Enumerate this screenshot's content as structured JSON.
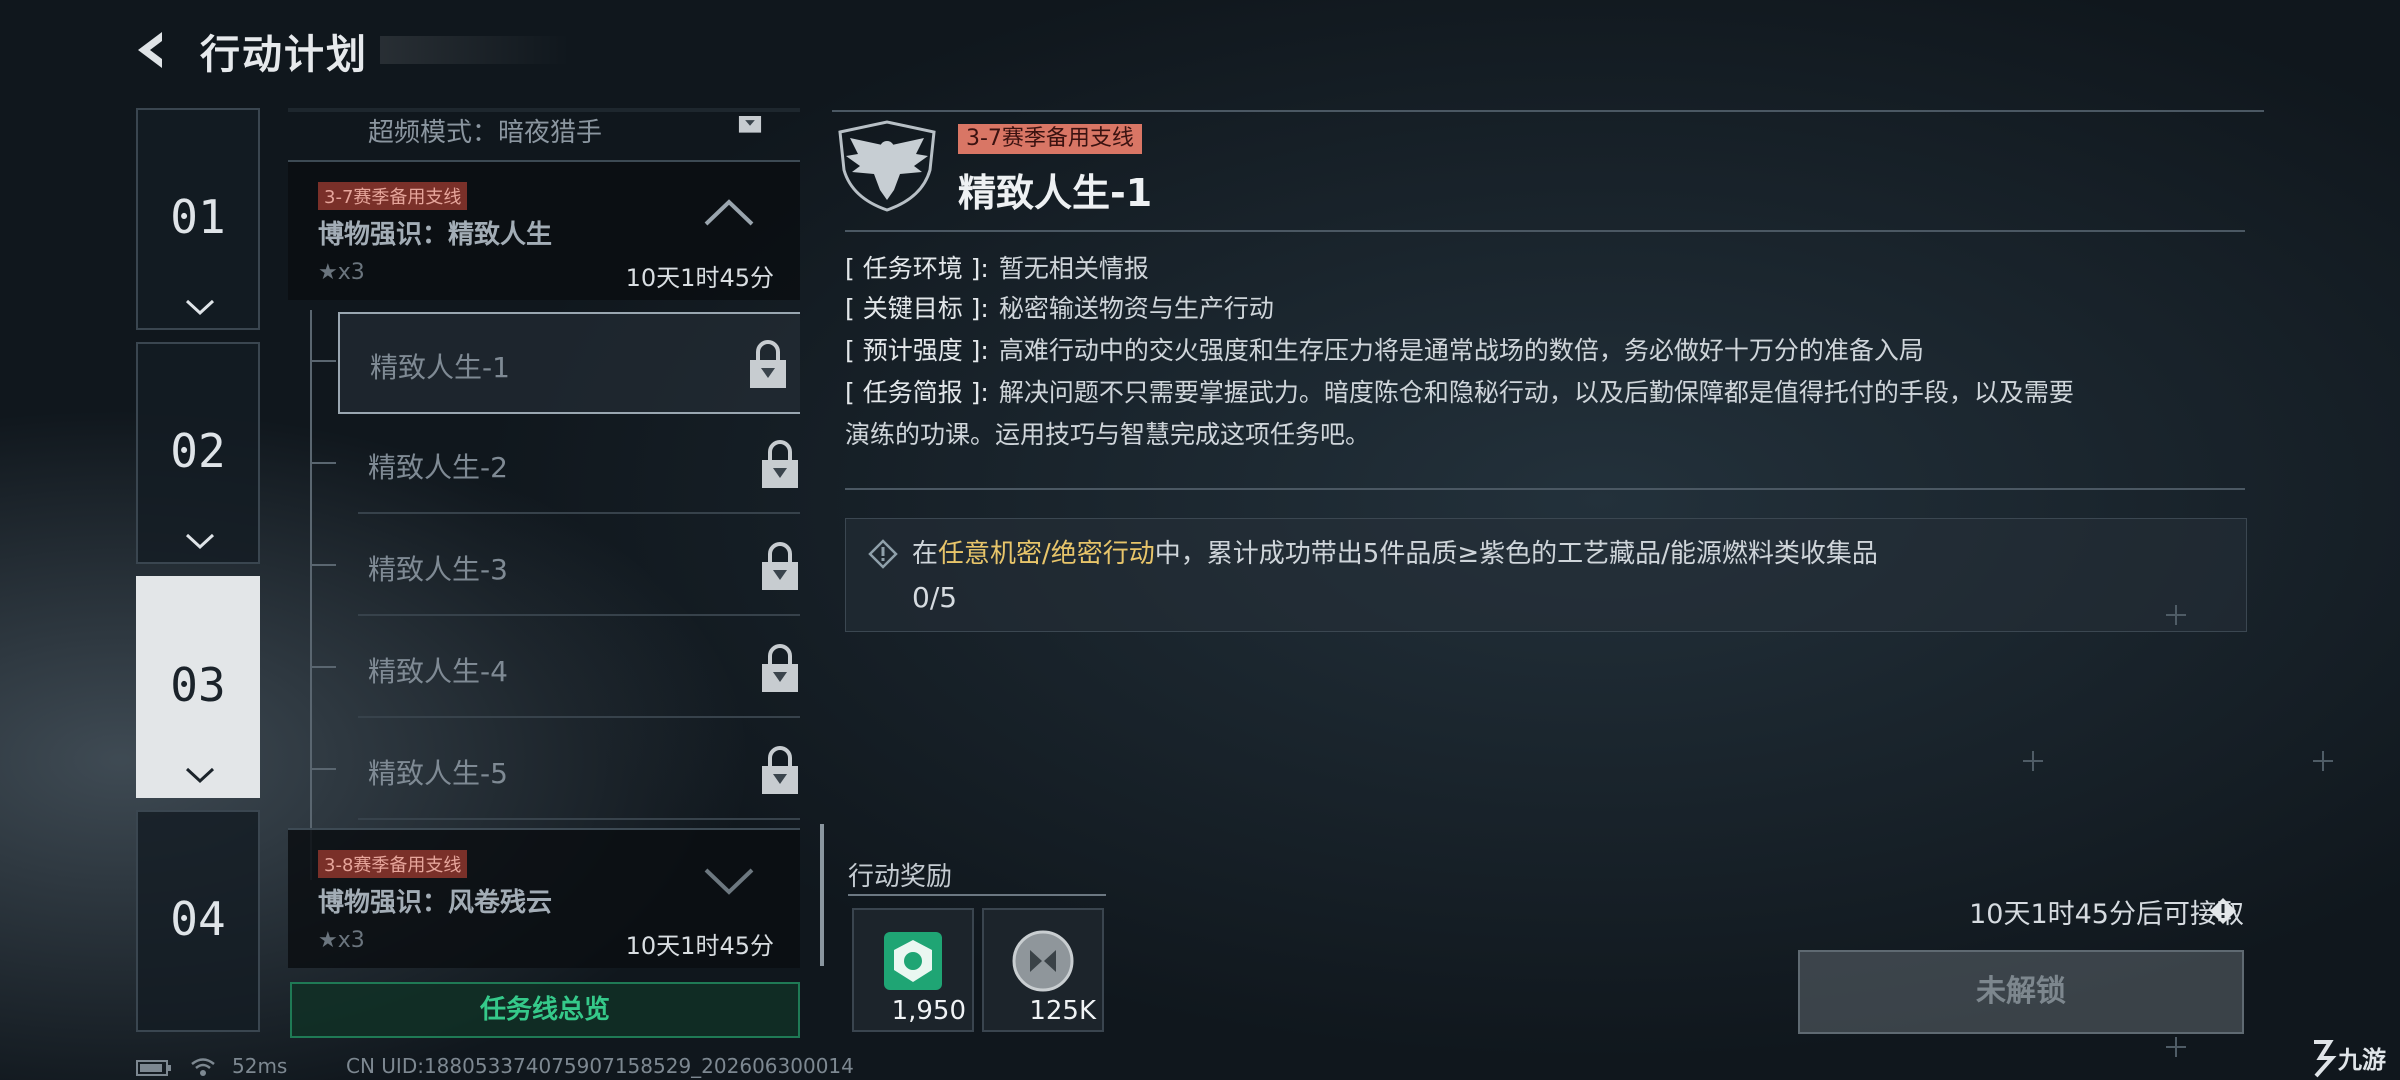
{
  "header": {
    "title": "行动计划",
    "back_icon": "back-arrow-icon"
  },
  "chapters": [
    {
      "label": "01",
      "active": false
    },
    {
      "label": "02",
      "active": false
    },
    {
      "label": "03",
      "active": true
    },
    {
      "label": "04",
      "active": false
    }
  ],
  "mission_list": {
    "cut_off_text": "超频模式：暗夜猎手",
    "groups": [
      {
        "tag": "3-7赛季备用支线",
        "title": "博物强识：精致人生",
        "stars": "★x3",
        "time": "10天1时45分",
        "expanded": true,
        "items": [
          {
            "label": "精致人生-1",
            "locked": true,
            "selected": true
          },
          {
            "label": "精致人生-2",
            "locked": true
          },
          {
            "label": "精致人生-3",
            "locked": true
          },
          {
            "label": "精致人生-4",
            "locked": true
          },
          {
            "label": "精致人生-5",
            "locked": true
          }
        ]
      },
      {
        "tag": "3-8赛季备用支线",
        "title": "博物强识：风卷残云",
        "stars": "★x3",
        "time": "10天1时45分",
        "expanded": false
      }
    ],
    "overview_button": "任务线总览"
  },
  "detail": {
    "tag": "3-7赛季备用支线",
    "title": "精致人生-1",
    "info": [
      {
        "key": "[ 任务环境 ]:",
        "value": "暂无相关情报"
      },
      {
        "key": "[ 关键目标 ]:",
        "value": "秘密输送物资与生产行动"
      },
      {
        "key": "[ 预计强度 ]:",
        "value": "高难行动中的交火强度和生存压力将是通常战场的数倍，务必做好十万分的准备入局"
      },
      {
        "key": "[ 任务简报 ]:",
        "value": "解决问题不只需要掌握武力。暗度陈仓和隐秘行动，以及后勤保障都是值得托付的手段，以及需要"
      },
      {
        "key": "",
        "value": "演练的功课。运用技巧与智慧完成这项任务吧。"
      }
    ],
    "task": {
      "prefix": "在",
      "highlight": "任意机密/绝密行动",
      "suffix": "中，累计成功带出5件品质≥紫色的工艺藏品/能源燃料类收集品",
      "progress": "0/5"
    },
    "rewards_label": "行动奖励",
    "rewards": [
      {
        "icon": "medal-icon",
        "count": "1,950",
        "color": "#1fa574"
      },
      {
        "icon": "coin-icon",
        "count": "125K",
        "color": "#9aa0a4"
      }
    ],
    "unlock_time": "10天1时45分后可接取",
    "locked_button": "未解锁"
  },
  "status_bar": {
    "ping": "52ms",
    "uid": "CN UID:1880533740759071585​29_202606300014"
  },
  "watermark": "九游"
}
